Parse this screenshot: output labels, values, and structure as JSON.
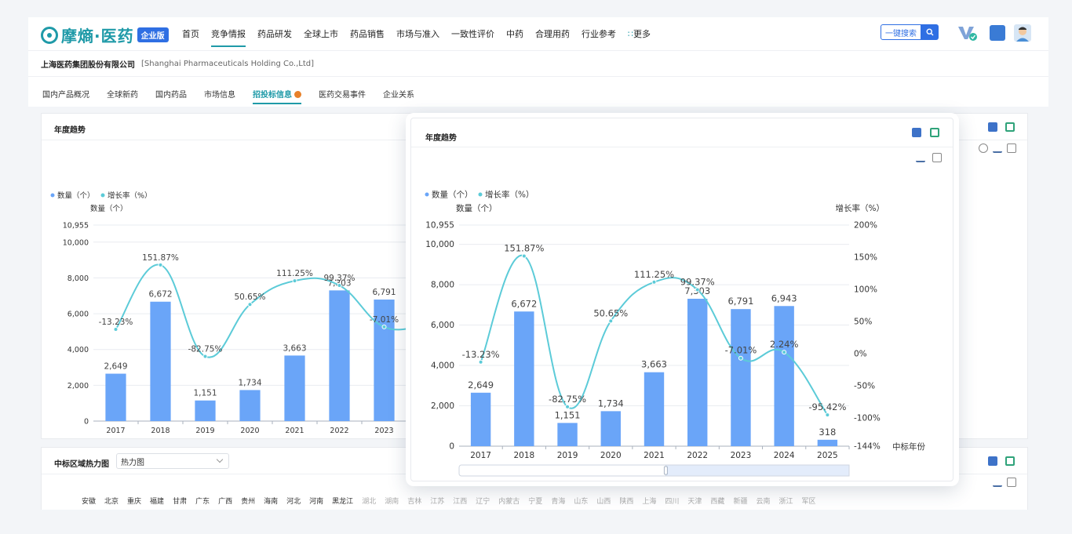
{
  "header": {
    "logo_text": "摩熵·医药",
    "logo_badge": "企业版",
    "nav": [
      "首页",
      "竞争情报",
      "药品研发",
      "全球上市",
      "药品销售",
      "市场与准入",
      "一致性评价",
      "中药",
      "合理用药",
      "行业参考"
    ],
    "nav_active_index": 1,
    "more_label": "更多",
    "search_label": "一键搜索"
  },
  "company": {
    "name": "上海医药集团股份有限公司",
    "name_en": "[Shanghai Pharmaceuticals Holding Co.,Ltd]"
  },
  "subtabs": [
    "国内产品概况",
    "全球新药",
    "国内药品",
    "市场信息",
    "招投标信息",
    "医药交易事件",
    "企业关系"
  ],
  "subtab_active_index": 4,
  "card1": {
    "title": "年度趋势"
  },
  "card2": {
    "title": "中标区域热力图",
    "select_value": "热力图"
  },
  "popup": {
    "title": "年度趋势"
  },
  "provinces": [
    "安徽",
    "北京",
    "重庆",
    "福建",
    "甘肃",
    "广东",
    "广西",
    "贵州",
    "海南",
    "河北",
    "河南",
    "黑龙江",
    "湖北",
    "湖南",
    "吉林",
    "江苏",
    "江西",
    "辽宁",
    "内蒙古",
    "宁夏",
    "青海",
    "山东",
    "山西",
    "陕西",
    "上海",
    "四川",
    "天津",
    "西藏",
    "新疆",
    "云南",
    "浙江",
    "军区"
  ],
  "colors": {
    "bar": "#6aa5f8",
    "line": "#5ccbd8",
    "accent": "#1f9aa8",
    "brand_blue": "#2f6fe3"
  },
  "chart_data": [
    {
      "type": "bar",
      "panel": "background",
      "title": "年度趋势",
      "legend": [
        "数量（个）",
        "增长率（%）"
      ],
      "ylabel": "数量（个）",
      "ylim": [
        0,
        10955
      ],
      "y_ticks": [
        "0",
        "2,000",
        "4,000",
        "6,000",
        "8,000",
        "10,000",
        "10,955"
      ],
      "categories": [
        "2017",
        "2018",
        "2019",
        "2020",
        "2021",
        "2022",
        "2023",
        "2024"
      ],
      "series": [
        {
          "name": "数量（个）",
          "values": [
            2649,
            6672,
            1151,
            1734,
            3663,
            7303,
            6791,
            6943
          ],
          "labels": [
            "2,649",
            "6,672",
            "1,151",
            "1,734",
            "3,663",
            "7,303",
            "6,791",
            "6,943"
          ]
        },
        {
          "name": "增长率（%）",
          "values": [
            -13.23,
            151.87,
            -82.75,
            50.65,
            111.25,
            99.37,
            -7.01,
            2.24
          ],
          "labels": [
            "-13.23%",
            "151.87%",
            "-82.75%",
            "50.65%",
            "111.25%",
            "99.37%",
            "-7.01%",
            "2.24%"
          ]
        }
      ]
    },
    {
      "type": "bar",
      "panel": "popup",
      "title": "年度趋势",
      "legend": [
        "数量（个）",
        "增长率（%）"
      ],
      "ylabel": "数量（个）",
      "ylabel_right": "增长率（%）",
      "xlabel": "中标年份",
      "ylim": [
        0,
        10955
      ],
      "y2lim": [
        -144,
        200
      ],
      "y_ticks": [
        "0",
        "2,000",
        "4,000",
        "6,000",
        "8,000",
        "10,000",
        "10,955"
      ],
      "y2_ticks": [
        "-144%",
        "-100%",
        "-50%",
        "0%",
        "50%",
        "100%",
        "150%",
        "200%"
      ],
      "categories": [
        "2017",
        "2018",
        "2019",
        "2020",
        "2021",
        "2022",
        "2023",
        "2024",
        "2025"
      ],
      "series": [
        {
          "name": "数量（个）",
          "values": [
            2649,
            6672,
            1151,
            1734,
            3663,
            7303,
            6791,
            6943,
            318
          ],
          "labels": [
            "2,649",
            "6,672",
            "1,151",
            "1,734",
            "3,663",
            "7,303",
            "6,791",
            "6,943",
            "318"
          ]
        },
        {
          "name": "增长率（%）",
          "values": [
            -13.23,
            151.87,
            -82.75,
            50.65,
            111.25,
            99.37,
            -7.01,
            2.24,
            -95.42
          ],
          "labels": [
            "-13.23%",
            "151.87%",
            "-82.75%",
            "50.65%",
            "111.25%",
            "99.37%",
            "-7.01%",
            "2.24%",
            "-95.42%"
          ]
        }
      ]
    }
  ]
}
